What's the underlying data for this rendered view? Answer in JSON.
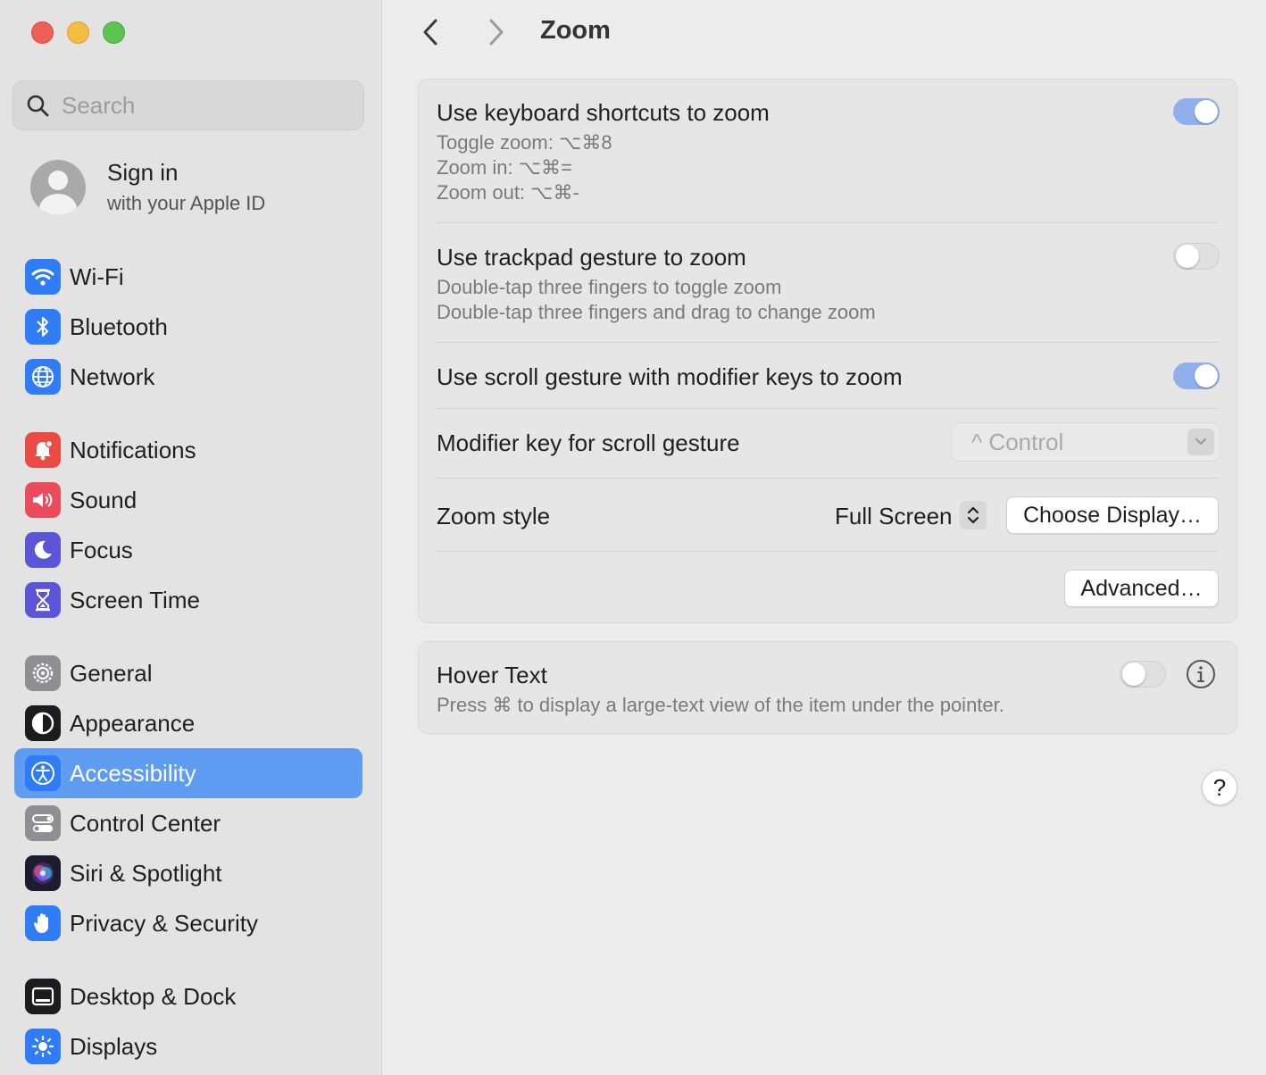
{
  "window": {
    "title": "Zoom"
  },
  "sidebar": {
    "search_placeholder": "Search",
    "account": {
      "title": "Sign in",
      "subtitle": "with your Apple ID"
    },
    "items": [
      {
        "label": "Wi-Fi",
        "icon": "wifi-icon",
        "color": "#2f7cf6"
      },
      {
        "label": "Bluetooth",
        "icon": "bluetooth-icon",
        "color": "#2f7cf6"
      },
      {
        "label": "Network",
        "icon": "globe-icon",
        "color": "#2f7cf6"
      },
      {
        "label": "Notifications",
        "icon": "bell-icon",
        "color": "#ec4b45"
      },
      {
        "label": "Sound",
        "icon": "speaker-icon",
        "color": "#ec4b5e"
      },
      {
        "label": "Focus",
        "icon": "moon-icon",
        "color": "#5a55d6"
      },
      {
        "label": "Screen Time",
        "icon": "hourglass-icon",
        "color": "#5a55d6"
      },
      {
        "label": "General",
        "icon": "gear-icon",
        "color": "#8e8e93"
      },
      {
        "label": "Appearance",
        "icon": "appearance-icon",
        "color": "#1c1c1e"
      },
      {
        "label": "Accessibility",
        "icon": "accessibility-icon",
        "color": "#2f7cf6",
        "selected": true
      },
      {
        "label": "Control Center",
        "icon": "control-center-icon",
        "color": "#8e8e93"
      },
      {
        "label": "Siri & Spotlight",
        "icon": "siri-icon",
        "color": "#3a2d6e"
      },
      {
        "label": "Privacy & Security",
        "icon": "hand-icon",
        "color": "#2f7cf6"
      },
      {
        "label": "Desktop & Dock",
        "icon": "dock-icon",
        "color": "#1c1c1e"
      },
      {
        "label": "Displays",
        "icon": "sun-icon",
        "color": "#2f7cf6"
      }
    ]
  },
  "zoom": {
    "keyboard": {
      "title": "Use keyboard shortcuts to zoom",
      "lines": [
        "Toggle zoom: ⌥⌘8",
        "Zoom in: ⌥⌘=",
        "Zoom out: ⌥⌘-"
      ],
      "enabled": true
    },
    "trackpad": {
      "title": "Use trackpad gesture to zoom",
      "lines": [
        "Double-tap three fingers to toggle zoom",
        "Double-tap three fingers and drag to change zoom"
      ],
      "enabled": false
    },
    "scroll": {
      "title": "Use scroll gesture with modifier keys to zoom",
      "enabled": true
    },
    "modifier": {
      "label": "Modifier key for scroll gesture",
      "value": "^ Control"
    },
    "style": {
      "label": "Zoom style",
      "value": "Full Screen",
      "choose_button": "Choose Display…"
    },
    "advanced_button": "Advanced…"
  },
  "hover_text": {
    "title": "Hover Text",
    "description": "Press ⌘ to display a large-text view of the item under the pointer.",
    "enabled": false
  },
  "help_label": "?"
}
